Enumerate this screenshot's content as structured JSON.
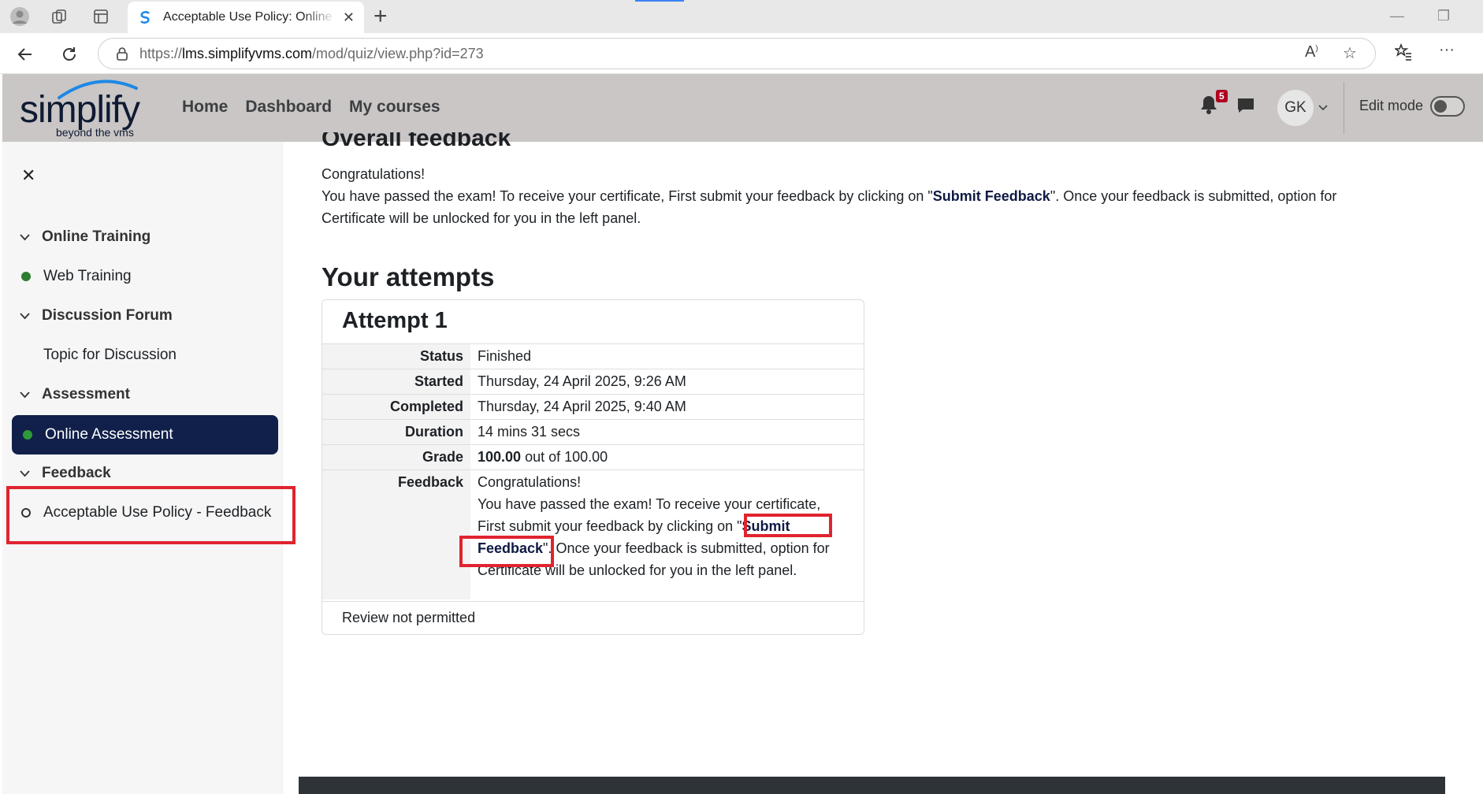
{
  "browser": {
    "tab_title": "Acceptable Use Policy: Online Assessment",
    "url_scheme": "https://",
    "url_host": "lms.simplifyvms.com",
    "url_path": "/mod/quiz/view.php?id=273"
  },
  "header": {
    "logo_word": "simplify",
    "logo_tagline": "beyond the vms",
    "nav": [
      "Home",
      "Dashboard",
      "My courses"
    ],
    "notification_count": "5",
    "avatar_initials": "GK",
    "edit_mode_label": "Edit mode"
  },
  "drawer": {
    "sections": [
      {
        "title": "Online Training",
        "items": [
          {
            "label": "Web Training",
            "status": "complete"
          }
        ]
      },
      {
        "title": "Discussion Forum",
        "items": [
          {
            "label": "Topic for Discussion",
            "status": "none"
          }
        ]
      },
      {
        "title": "Assessment",
        "items": [
          {
            "label": "Online Assessment",
            "status": "complete",
            "active": true
          }
        ]
      },
      {
        "title": "Feedback",
        "items": [
          {
            "label": "Acceptable Use Policy - Feedback",
            "status": "incomplete"
          }
        ]
      }
    ]
  },
  "content": {
    "overall_feedback_heading": "Overall feedback",
    "congrats": "Congratulations!",
    "msg_pre": "You have passed the exam! To receive your certificate, First submit your feedback by clicking on \"",
    "msg_bold": "Submit Feedback",
    "msg_post_line1": "\". Once your feedback is submitted, option for",
    "msg_post_line2": "Certificate will be unlocked for you in the left panel.",
    "attempts_heading": "Your attempts",
    "attempt": {
      "title": "Attempt 1",
      "rows": [
        {
          "label": "Status",
          "value": "Finished"
        },
        {
          "label": "Started",
          "value": "Thursday, 24 April 2025, 9:26 AM"
        },
        {
          "label": "Completed",
          "value": "Thursday, 24 April 2025, 9:40 AM"
        },
        {
          "label": "Duration",
          "value": "14 mins 31 secs"
        }
      ],
      "grade_label": "Grade",
      "grade_value": "100.00",
      "grade_suffix": " out of 100.00",
      "feedback_label": "Feedback",
      "feedback_l1": "Congratulations!",
      "feedback_l2": "You have passed the exam! To receive your certificate,",
      "feedback_l3_pre": "First submit your feedback by clicking on \"",
      "feedback_bold_1": "Submit",
      "feedback_bold_2": "Feedback",
      "feedback_l4_post": "\". Once your feedback is submitted, option for",
      "feedback_l5": "Certificate will be unlocked for you in the left panel.",
      "review": "Review not permitted"
    }
  },
  "colors": {
    "header_bg": "#c9c6c5",
    "active_item_bg": "#11204a",
    "complete_dot": "#2e7d32",
    "highlight_red": "#e0242f"
  }
}
